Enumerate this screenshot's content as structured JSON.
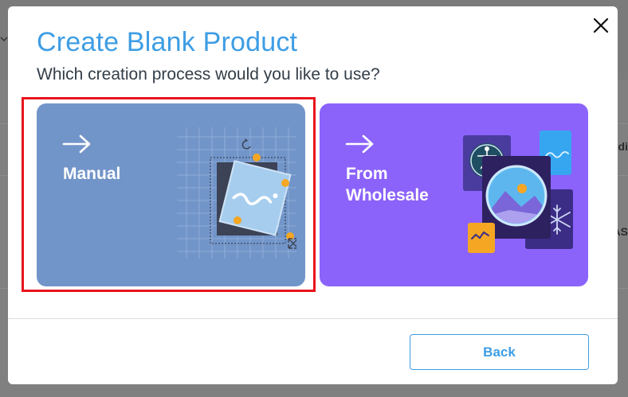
{
  "background": {
    "edge_text_right_1": "di",
    "edge_text_right_2": "AS"
  },
  "modal": {
    "title": "Create Blank Product",
    "subtitle": "Which creation process would you like to use?",
    "close_icon": "close-icon",
    "options": [
      {
        "label": "Manual",
        "icon": "arrow-right-icon",
        "selected": true
      },
      {
        "label": "From Wholesale",
        "icon": "arrow-right-icon",
        "selected": false
      }
    ],
    "footer": {
      "back_label": "Back"
    }
  },
  "colors": {
    "title": "#3e9de4",
    "manual_card": "#7295c9",
    "wholesale_card": "#8b63fb",
    "selection_outline": "#e8141c",
    "back_button": "#3e9de4"
  }
}
